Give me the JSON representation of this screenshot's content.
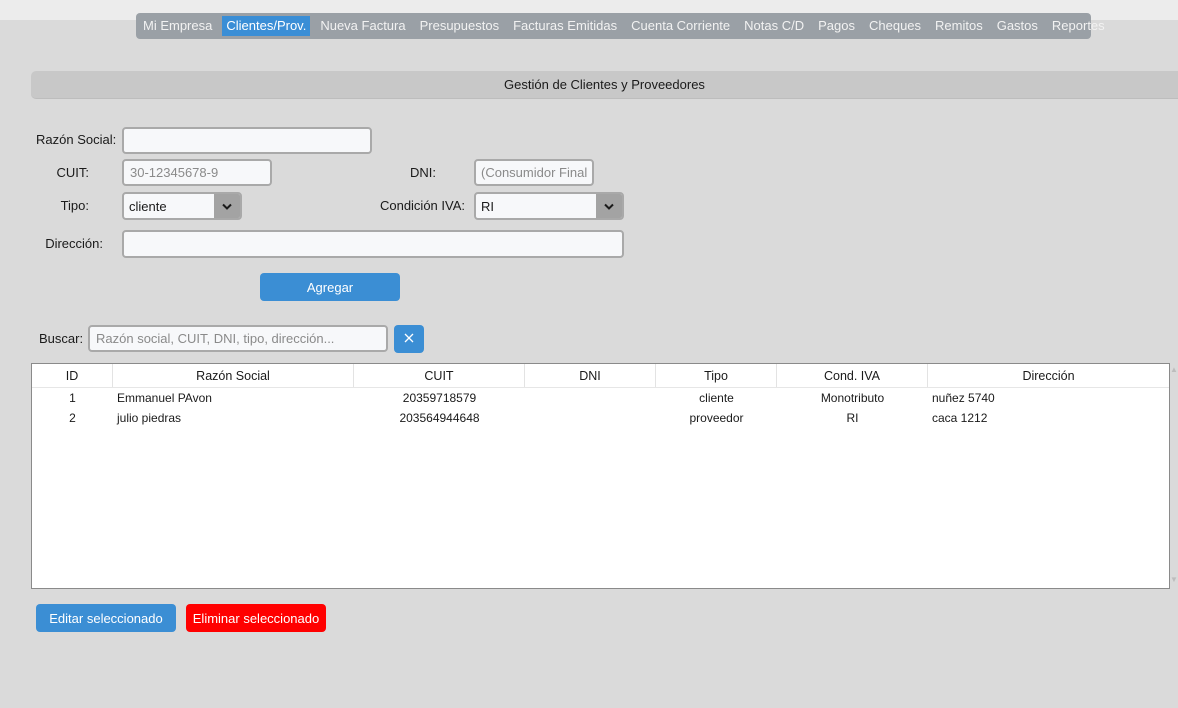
{
  "nav": {
    "items": [
      {
        "label": "Mi Empresa",
        "active": false
      },
      {
        "label": "Clientes/Prov.",
        "active": true
      },
      {
        "label": "Nueva Factura",
        "active": false
      },
      {
        "label": "Presupuestos",
        "active": false
      },
      {
        "label": "Facturas Emitidas",
        "active": false
      },
      {
        "label": "Cuenta Corriente",
        "active": false
      },
      {
        "label": "Notas C/D",
        "active": false
      },
      {
        "label": "Pagos",
        "active": false
      },
      {
        "label": "Cheques",
        "active": false
      },
      {
        "label": "Remitos",
        "active": false
      },
      {
        "label": "Gastos",
        "active": false
      },
      {
        "label": "Reportes",
        "active": false
      }
    ],
    "active_color": "#3a8ed6",
    "bar_color": "#9aa0a6"
  },
  "section": {
    "title": "Gestión de Clientes y Proveedores"
  },
  "form": {
    "razon_label": "Razón Social:",
    "razon_value": "",
    "cuit_label": "CUIT:",
    "cuit_placeholder": "30-12345678-9",
    "dni_label": "DNI:",
    "dni_placeholder": "(Consumidor Final)",
    "tipo_label": "Tipo:",
    "tipo_value": "cliente",
    "iva_label": "Condición IVA:",
    "iva_value": "RI",
    "direccion_label": "Dirección:",
    "direccion_value": "",
    "add_button": "Agregar"
  },
  "search": {
    "label": "Buscar:",
    "placeholder": "Razón social, CUIT, DNI, tipo, dirección...",
    "clear_icon": "close-icon"
  },
  "table": {
    "columns": [
      "ID",
      "Razón Social",
      "CUIT",
      "DNI",
      "Tipo",
      "Cond. IVA",
      "Dirección"
    ],
    "rows": [
      [
        "1",
        "Emmanuel PAvon",
        "20359718579",
        "",
        "cliente",
        "Monotributo",
        "nuñez 5740"
      ],
      [
        "2",
        "julio piedras",
        "203564944648",
        "",
        "proveedor",
        "RI",
        "caca 1212"
      ]
    ]
  },
  "actions": {
    "edit_button": "Editar seleccionado",
    "delete_button": "Eliminar seleccionado",
    "edit_color": "#3b8ed4",
    "delete_color": "#ff0000"
  }
}
